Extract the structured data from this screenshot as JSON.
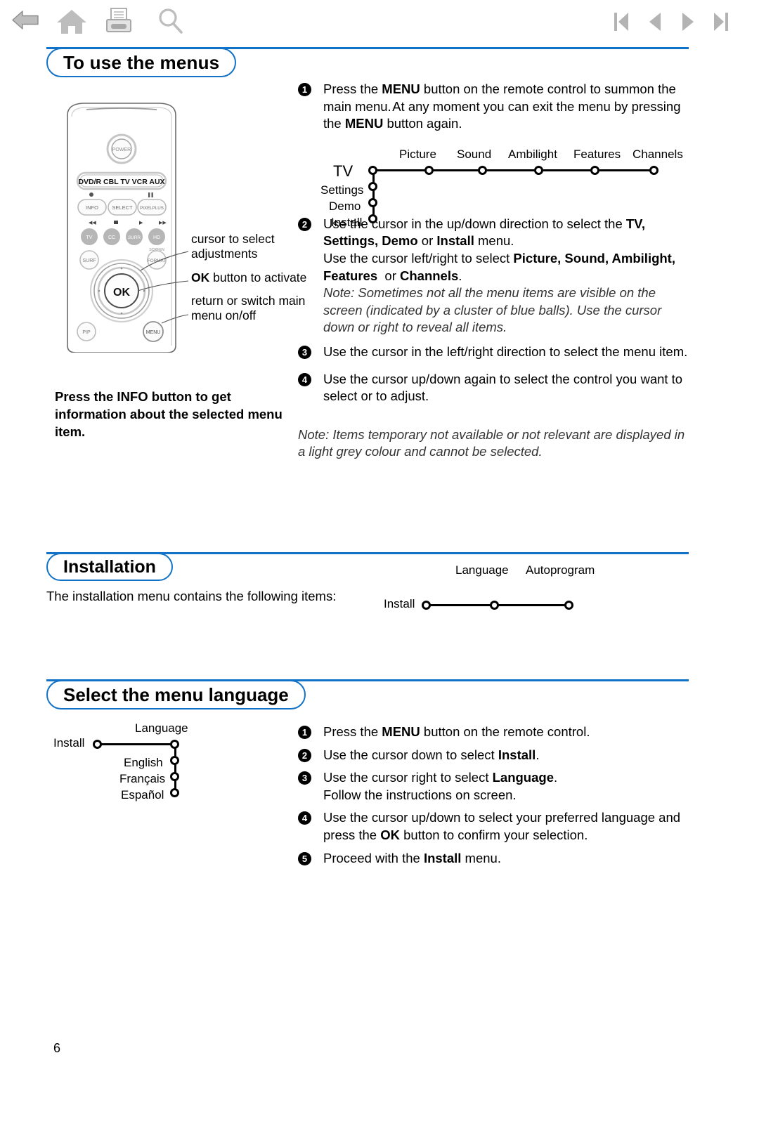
{
  "toolbar": {
    "icons": [
      {
        "name": "back-icon",
        "label": "Back"
      },
      {
        "name": "home-icon",
        "label": "Home"
      },
      {
        "name": "print-icon",
        "label": "Print"
      },
      {
        "name": "search-icon",
        "label": "Search"
      }
    ],
    "nav_icons": [
      {
        "name": "first-page-icon",
        "label": "First page"
      },
      {
        "name": "previous-page-icon",
        "label": "Previous page"
      },
      {
        "name": "next-page-icon",
        "label": "Next page"
      },
      {
        "name": "last-page-icon",
        "label": "Last page"
      }
    ]
  },
  "colors": {
    "accent": "#1272c8",
    "icon_grey": "#b3b3b3",
    "text": "#000000"
  },
  "sections": {
    "menus": {
      "title": "To use the menus",
      "steps": [
        {
          "num": "1",
          "parts": [
            {
              "t": "Press the ",
              "b": false
            },
            {
              "t": "MENU",
              "b": true
            },
            {
              "t": " button on the remote control to summon the main menu. At any moment you can exit the menu by pressing the ",
              "b": false
            },
            {
              "t": "MENU",
              "b": true
            },
            {
              "t": " button again.",
              "b": false
            }
          ]
        },
        {
          "num": "2",
          "parts": [
            {
              "t": "Use the cursor in the up/down direction to select the ",
              "b": false
            },
            {
              "t": "TV, Settings, Demo",
              "b": true
            },
            {
              "t": " or ",
              "b": false
            },
            {
              "t": "Install",
              "b": true
            },
            {
              "t": " menu.",
              "b": false
            },
            {
              "t": "\n",
              "b": false
            },
            {
              "t": "Use the cursor left/right to select ",
              "b": false
            },
            {
              "t": "Picture, Sound, Ambilight, Features",
              "b": true
            },
            {
              "t": "  or ",
              "b": false
            },
            {
              "t": "Channels",
              "b": true
            },
            {
              "t": ".",
              "b": false
            }
          ],
          "note": "Note: Sometimes not all the menu items are visible on the screen (indicated by a cluster of blue balls). Use the cursor down or right to reveal all items."
        },
        {
          "num": "3",
          "parts": [
            {
              "t": "Use the cursor in the left/right direction to select the menu item.",
              "b": false
            }
          ]
        },
        {
          "num": "4",
          "parts": [
            {
              "t": "Use the cursor up/down again to select the control you want to select or to adjust.",
              "b": false
            }
          ]
        }
      ],
      "closing_note": "Note: Items temporary not available or not relevant are displayed in a light grey colour and cannot be selected.",
      "callouts": [
        {
          "prefix": "",
          "bold": "",
          "text": "cursor to select adjustments"
        },
        {
          "prefix": "",
          "bold": "OK",
          "text": " button to activate"
        },
        {
          "prefix": "",
          "bold": "",
          "text": "return or switch main menu on/off"
        }
      ],
      "info_note": "Press the INFO button to get information about the selected menu item."
    },
    "installation": {
      "title": "Installation",
      "body": "The installation menu contains the following items:"
    },
    "language": {
      "title": "Select the menu language",
      "steps": [
        {
          "num": "1",
          "parts": [
            {
              "t": "Press the ",
              "b": false
            },
            {
              "t": "MENU",
              "b": true
            },
            {
              "t": " button on the remote control.",
              "b": false
            }
          ]
        },
        {
          "num": "2",
          "parts": [
            {
              "t": "Use the cursor down to select ",
              "b": false
            },
            {
              "t": "Install",
              "b": true
            },
            {
              "t": ".",
              "b": false
            }
          ]
        },
        {
          "num": "3",
          "parts": [
            {
              "t": "Use the cursor right to select ",
              "b": false
            },
            {
              "t": "Language",
              "b": true
            },
            {
              "t": ".",
              "b": false
            },
            {
              "t": "\n",
              "b": false
            },
            {
              "t": "Follow the instructions on screen.",
              "b": false
            }
          ]
        },
        {
          "num": "4",
          "parts": [
            {
              "t": "Use the cursor up/down to select your preferred language and press the ",
              "b": false
            },
            {
              "t": "OK",
              "b": true
            },
            {
              "t": " button to confirm your selection.",
              "b": false
            }
          ]
        },
        {
          "num": "5",
          "parts": [
            {
              "t": "Proceed with the ",
              "b": false
            },
            {
              "t": "Install",
              "b": true
            },
            {
              "t": " menu.",
              "b": false
            }
          ]
        }
      ]
    }
  },
  "menu_tree_main": {
    "root": "TV",
    "vertical_items": [
      "Settings",
      "Demo",
      "Install"
    ],
    "horizontal_items": [
      "Picture",
      "Sound",
      "Ambilight",
      "Features",
      "Channels"
    ]
  },
  "menu_tree_install": {
    "root": "Install",
    "horizontal_items": [
      "Language",
      "Autoprogram"
    ]
  },
  "menu_tree_language": {
    "root": "Install",
    "branch": "Language",
    "vertical_items": [
      "English",
      "Français",
      "Español"
    ]
  },
  "remote": {
    "power_label": "POWER",
    "source_row": [
      "DVD/R",
      "CBL",
      "TV",
      "VCR",
      "AUX"
    ],
    "row2": [
      "INFO",
      "SELECT",
      "PIXELPLUS"
    ],
    "row3": [
      "TV",
      "CC",
      "SURR",
      "HD"
    ],
    "row4_left": "SURF",
    "row4_right": "FORMAT",
    "row4_right_top": "SCREEN",
    "ok_label": "OK",
    "bottom_left": "PIP",
    "bottom_right": "MENU"
  },
  "page_number": "6"
}
